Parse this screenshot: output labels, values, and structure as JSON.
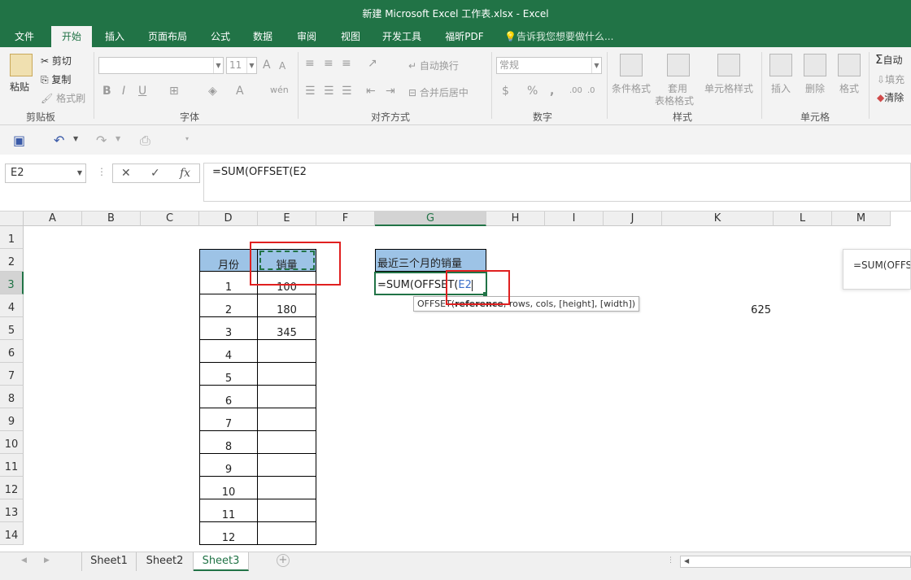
{
  "window": {
    "title": "新建 Microsoft Excel 工作表.xlsx - Excel"
  },
  "tabs": [
    "文件",
    "开始",
    "插入",
    "页面布局",
    "公式",
    "数据",
    "审阅",
    "视图",
    "开发工具",
    "福昕PDF"
  ],
  "tell_me": "告诉我您想要做什么...",
  "ribbon": {
    "clipboard": {
      "label": "剪贴板",
      "paste": "粘贴",
      "cut": "剪切",
      "copy": "复制",
      "painter": "格式刷"
    },
    "font": {
      "label": "字体",
      "size": "11"
    },
    "alignment": {
      "label": "对齐方式",
      "wrap": "自动换行",
      "merge": "合并后居中"
    },
    "number": {
      "label": "数字",
      "format": "常规"
    },
    "styles": {
      "label": "样式",
      "cond": "条件格式",
      "table1": "套用",
      "table2": "表格格式",
      "cellstyle": "单元格样式"
    },
    "cells": {
      "label": "单元格",
      "insert": "插入",
      "delete": "删除",
      "format": "格式"
    },
    "editing": {
      "autosum": "自动",
      "fill": "填充",
      "clear": "清除"
    }
  },
  "formula_bar": {
    "name_box": "E2",
    "formula": "=SUM(OFFSET(E2",
    "fx": "fx"
  },
  "columns": [
    "A",
    "B",
    "C",
    "D",
    "E",
    "F",
    "G",
    "H",
    "I",
    "J",
    "K",
    "L",
    "M"
  ],
  "rows": [
    "1",
    "2",
    "3",
    "4",
    "5",
    "6",
    "7",
    "8",
    "9",
    "10",
    "11",
    "12",
    "13",
    "14"
  ],
  "table": {
    "month_header": "月份",
    "sales_header": "销量",
    "months": [
      "1",
      "2",
      "3",
      "4",
      "5",
      "6",
      "7",
      "8",
      "9",
      "10",
      "11",
      "12"
    ],
    "sales": [
      "100",
      "180",
      "345",
      "",
      "",
      "",
      "",
      "",
      "",
      "",
      "",
      ""
    ]
  },
  "g_header": "最近三个月的销量",
  "g3_prefix": "=SUM(OFFSET(",
  "g3_ref": "E2",
  "tooltip": {
    "func": "OFFSET(",
    "arg": "reference",
    "rest": ", rows, cols, [height], [width])"
  },
  "k4_value": "625",
  "side_formula": "=SUM(OFFS",
  "sheets": [
    "Sheet1",
    "Sheet2",
    "Sheet3"
  ],
  "colors": {
    "excel_green": "#217346",
    "header_fill": "#9dc3e6",
    "highlight_red": "#e02020",
    "ref_blue": "#3b6fc9"
  }
}
